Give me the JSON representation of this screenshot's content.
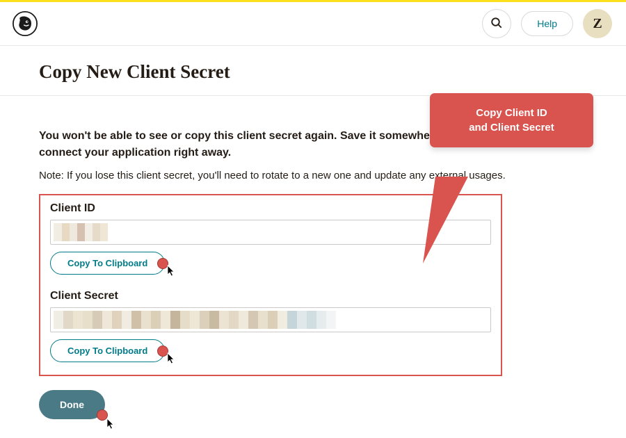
{
  "header": {
    "help_label": "Help",
    "avatar_initial": "Z"
  },
  "page": {
    "title": "Copy New Client Secret",
    "warning": "You won't be able to see or copy this client secret again. Save it somewhere secure, or use it to connect your application right away.",
    "note": "Note: If you lose this client secret, you'll need to rotate to a new one and update any external usages."
  },
  "fields": {
    "client_id": {
      "label": "Client ID",
      "copy_label": "Copy To Clipboard"
    },
    "client_secret": {
      "label": "Client Secret",
      "copy_label": "Copy To Clipboard"
    }
  },
  "actions": {
    "done_label": "Done"
  },
  "callout": {
    "line1": "Copy Client ID",
    "line2": "and Client Secret"
  }
}
